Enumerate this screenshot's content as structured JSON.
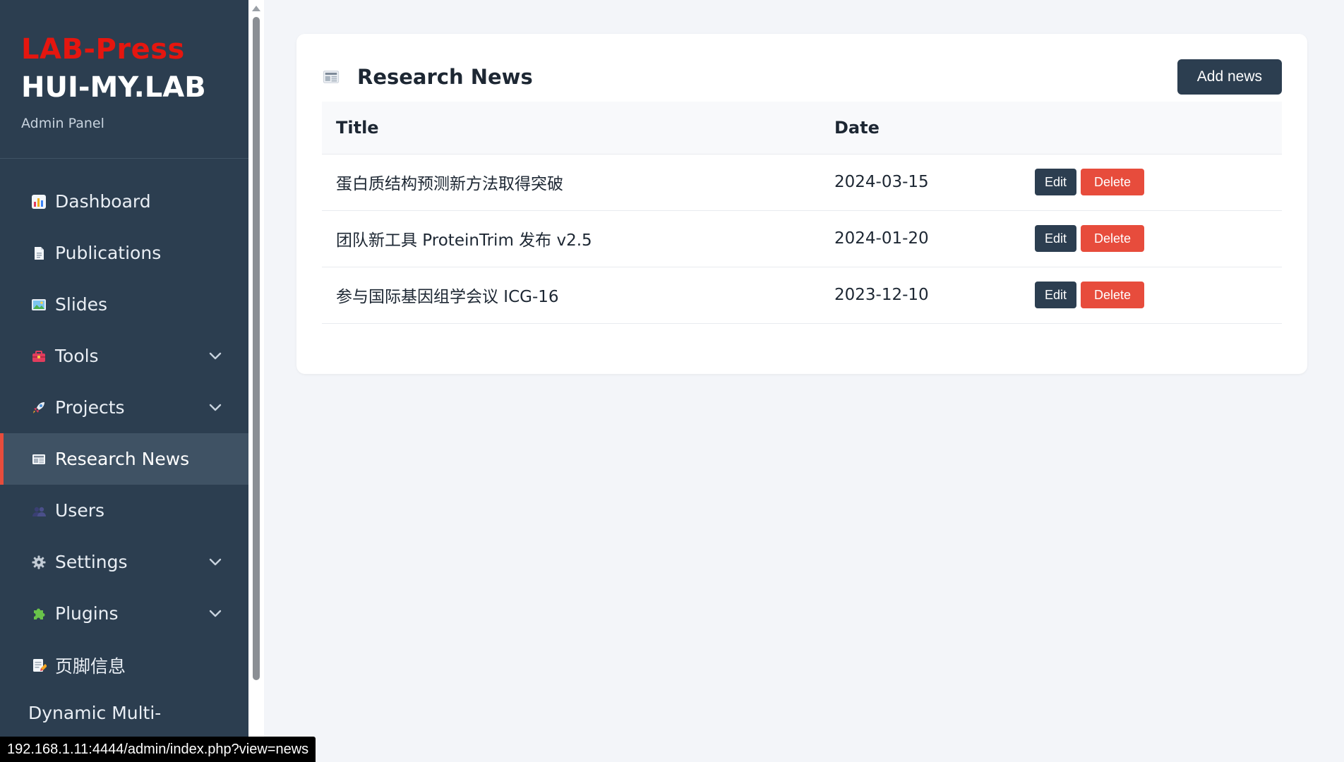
{
  "sidebar": {
    "brand_title": "LAB-Press",
    "brand_subtitle": "HUI-MY.LAB",
    "brand_caption": "Admin Panel",
    "items": [
      {
        "label": "Dashboard",
        "icon": "bar-chart-icon",
        "has_chevron": false,
        "active": false
      },
      {
        "label": "Publications",
        "icon": "document-icon",
        "has_chevron": false,
        "active": false
      },
      {
        "label": "Slides",
        "icon": "image-icon",
        "has_chevron": false,
        "active": false
      },
      {
        "label": "Tools",
        "icon": "toolbox-icon",
        "has_chevron": true,
        "active": false
      },
      {
        "label": "Projects",
        "icon": "rocket-icon",
        "has_chevron": true,
        "active": false
      },
      {
        "label": "Research News",
        "icon": "newspaper-icon",
        "has_chevron": false,
        "active": true
      },
      {
        "label": "Users",
        "icon": "users-icon",
        "has_chevron": false,
        "active": false
      },
      {
        "label": "Settings",
        "icon": "gear-icon",
        "has_chevron": true,
        "active": false
      },
      {
        "label": "Plugins",
        "icon": "puzzle-icon",
        "has_chevron": true,
        "active": false
      },
      {
        "label": "页脚信息",
        "icon": "memo-icon",
        "has_chevron": false,
        "active": false
      }
    ],
    "extra_label": "Dynamic Multi-"
  },
  "main": {
    "title": "Research News",
    "title_icon": "newspaper-icon",
    "add_button": "Add news",
    "table": {
      "columns": [
        "Title",
        "Date",
        ""
      ],
      "rows": [
        {
          "title": "蛋白质结构预测新方法取得突破",
          "date": "2024-03-15",
          "edit": "Edit",
          "delete": "Delete"
        },
        {
          "title": "团队新工具 ProteinTrim 发布 v2.5",
          "date": "2024-01-20",
          "edit": "Edit",
          "delete": "Delete"
        },
        {
          "title": "参与国际基因组学会议 ICG-16",
          "date": "2023-12-10",
          "edit": "Edit",
          "delete": "Delete"
        }
      ]
    }
  },
  "statusbar": {
    "url": "192.168.1.11:4444/admin/index.php?view=news"
  },
  "colors": {
    "sidebar_bg": "#2c3e50",
    "accent_red": "#e74c3c",
    "brand_red": "#e5160f",
    "active_item_bg": "#3f5264",
    "page_bg": "#f3f5f9"
  }
}
